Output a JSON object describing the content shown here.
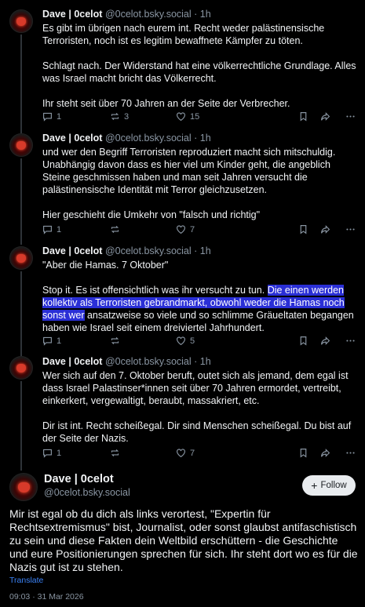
{
  "posts": [
    {
      "name": "Dave | 0celot",
      "handle": "@0celot.bsky.social",
      "time": "· 1h",
      "paragraphs": [
        "Es gibt im übrigen nach eurem int. Recht weder palästinensische Terroristen, noch ist es legitim bewaffnete Kämpfer zu töten.",
        "Schlagt nach. Der Widerstand hat eine völkerrechtliche Grundlage. Alles was Israel macht bricht das Völkerrecht.",
        "Ihr steht seit über 70 Jahren an der Seite der Verbrecher."
      ],
      "replies": "1",
      "reposts": "3",
      "likes": "15"
    },
    {
      "name": "Dave | 0celot",
      "handle": "@0celot.bsky.social",
      "time": "· 1h",
      "paragraphs": [
        "und wer den Begriff Terroristen reproduziert macht sich mitschuldig. Unabhängig davon dass es hier viel um Kinder geht, die angeblich Steine geschmissen haben und man seit Jahren versucht die palästinensische Identität mit Terror gleichzusetzen.",
        "Hier geschieht die Umkehr von \"falsch und richtig\""
      ],
      "replies": "1",
      "reposts": "",
      "likes": "7"
    },
    {
      "name": "Dave | 0celot",
      "handle": "@0celot.bsky.social",
      "time": "· 1h",
      "p1": "\"Aber die Hamas. 7 Oktober\"",
      "p2_before": "Stop it. Es ist offensichtlich was ihr versucht zu tun. ",
      "p2_highlight": "Die einen werden kollektiv als Terroristen gebrandmarkt, obwohl weder die Hamas noch sonst wer",
      "p2_after": " ansatzweise so viele und so schlimme Gräueltaten begangen haben wie Israel seit einem dreiviertel Jahrhundert.",
      "replies": "1",
      "reposts": "",
      "likes": "5"
    },
    {
      "name": "Dave | 0celot",
      "handle": "@0celot.bsky.social",
      "time": "· 1h",
      "paragraphs": [
        "Wer sich auf den 7. Oktober beruft, outet sich als jemand, dem egal ist dass Israel Palastinser*innen seit über 70 Jahren ermordet, vertreibt, einkerkert, vergewaltigt, beraubt, massakriert, etc.",
        "Dir ist int. Recht scheißegal. Dir sind Menschen scheißegal. Du bist auf der Seite der Nazis."
      ],
      "replies": "1",
      "reposts": "",
      "likes": "7"
    }
  ],
  "main_post": {
    "name": "Dave | 0celot",
    "handle": "@0celot.bsky.social",
    "follow_label": "Follow",
    "text": "Mir ist egal ob du dich als links verortest, \"Expertin für Rechtsextremismus\" bist, Journalist, oder sonst glaubst antifaschistisch zu sein und diese Fakten dein Weltbild erschüttern - die Geschichte und eure Positionierungen sprechen für sich. Ihr steht dort wo es für die Nazis gut ist zu stehen.",
    "translate_label": "Translate",
    "timestamp": "09:03 · 31 Mar 2026"
  },
  "colors": {
    "background": "#000000",
    "text": "#f1f3f5",
    "muted": "#8a96a3",
    "highlight": "#2a2fd6",
    "link": "#3b82f6"
  }
}
